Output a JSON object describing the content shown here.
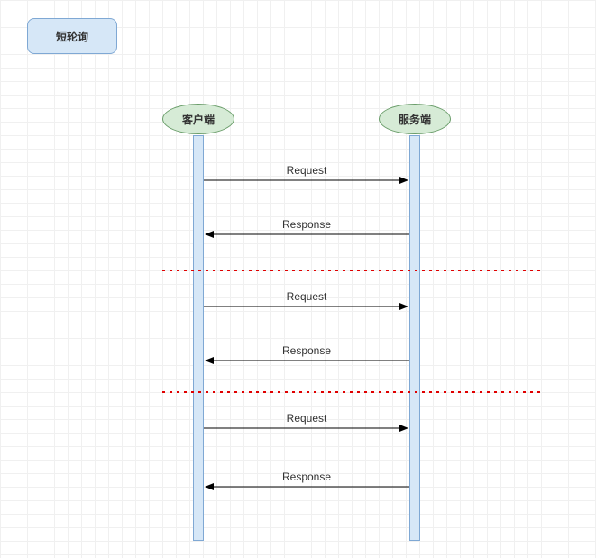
{
  "title": "短轮询",
  "participants": {
    "client": "客户端",
    "server": "服务端"
  },
  "messages": [
    {
      "label": "Request"
    },
    {
      "label": "Response"
    },
    {
      "label": "Request"
    },
    {
      "label": "Response"
    },
    {
      "label": "Request"
    },
    {
      "label": "Response"
    }
  ],
  "chart_data": {
    "type": "sequence",
    "title": "短轮询",
    "participants": [
      "客户端",
      "服务端"
    ],
    "messages": [
      {
        "from": "客户端",
        "to": "服务端",
        "label": "Request"
      },
      {
        "from": "服务端",
        "to": "客户端",
        "label": "Response"
      },
      {
        "separator": true
      },
      {
        "from": "客户端",
        "to": "服务端",
        "label": "Request"
      },
      {
        "from": "服务端",
        "to": "客户端",
        "label": "Response"
      },
      {
        "separator": true
      },
      {
        "from": "客户端",
        "to": "服务端",
        "label": "Request"
      },
      {
        "from": "服务端",
        "to": "客户端",
        "label": "Response"
      }
    ]
  }
}
